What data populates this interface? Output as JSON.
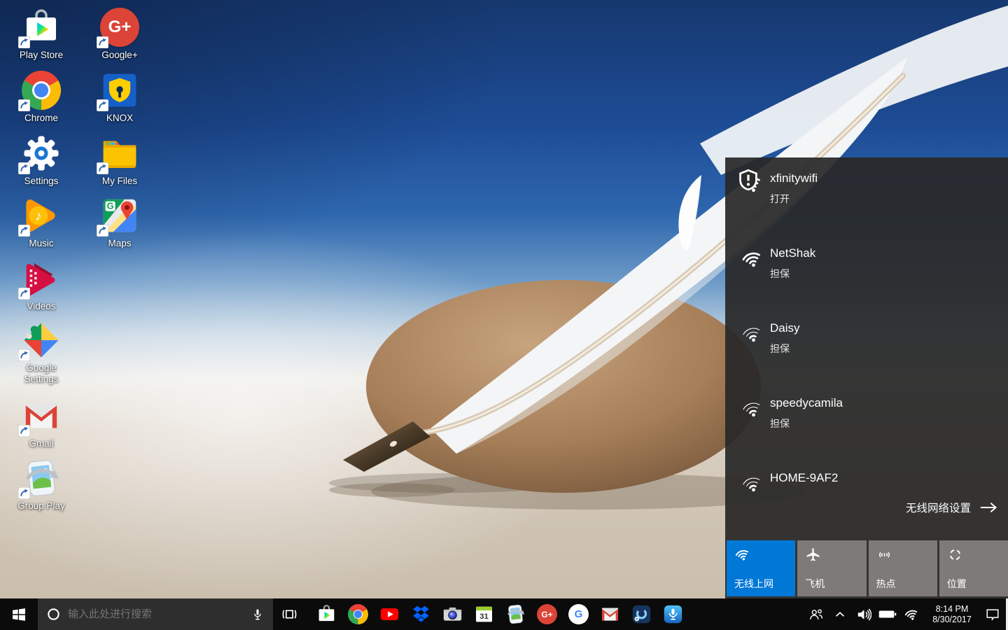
{
  "desktop": {
    "icons": [
      {
        "label": "Play Store",
        "icon": "play-store"
      },
      {
        "label": "Google+",
        "icon": "google-plus"
      },
      {
        "label": "Chrome",
        "icon": "chrome"
      },
      {
        "label": "KNOX",
        "icon": "knox"
      },
      {
        "label": "Settings",
        "icon": "settings-gear"
      },
      {
        "label": "My Files",
        "icon": "my-files-folder"
      },
      {
        "label": "Music",
        "icon": "play-music"
      },
      {
        "label": "Maps",
        "icon": "google-maps"
      },
      {
        "label": "Videos",
        "icon": "play-movies"
      },
      {
        "label": "Google Settings",
        "icon": "google-settings-puzzle"
      },
      {
        "label": "Gmail",
        "icon": "gmail-envelope"
      },
      {
        "label": "Group Play",
        "icon": "group-play"
      }
    ]
  },
  "wifi_panel": {
    "networks": [
      {
        "name": "xfinitywifi",
        "status": "打开",
        "signal": "strong",
        "open": true
      },
      {
        "name": "NetShak",
        "status": "担保",
        "signal": "strong",
        "open": false
      },
      {
        "name": "Daisy",
        "status": "担保",
        "signal": "weak",
        "open": false
      },
      {
        "name": "speedycamila",
        "status": "担保",
        "signal": "weak",
        "open": false
      },
      {
        "name": "HOME-9AF2",
        "status": "",
        "signal": "weak",
        "open": false
      }
    ],
    "settings_link": "无线网络设置",
    "quick_actions": [
      {
        "label": "无线上网",
        "icon": "wifi-icon",
        "active": true
      },
      {
        "label": "飞机",
        "icon": "airplane-icon",
        "active": false
      },
      {
        "label": "热点",
        "icon": "hotspot-icon",
        "active": false
      },
      {
        "label": "位置",
        "icon": "location-icon",
        "active": false
      }
    ],
    "accent_color": "#0078d7"
  },
  "taskbar": {
    "search_placeholder": "输入此处进行搜索",
    "app_icons": [
      "play-store",
      "chrome",
      "youtube",
      "dropbox",
      "camera",
      "calendar",
      "gallery",
      "google-plus",
      "google",
      "gmail",
      "s-voice",
      "voice-recorder"
    ],
    "calendar_day": "31",
    "tray": {
      "time": "8:14 PM",
      "date": "8/30/2017"
    }
  },
  "icon_text": {
    "google_plus": "G+",
    "google_g": "G",
    "maps_g": "G",
    "music_note": "♪"
  }
}
